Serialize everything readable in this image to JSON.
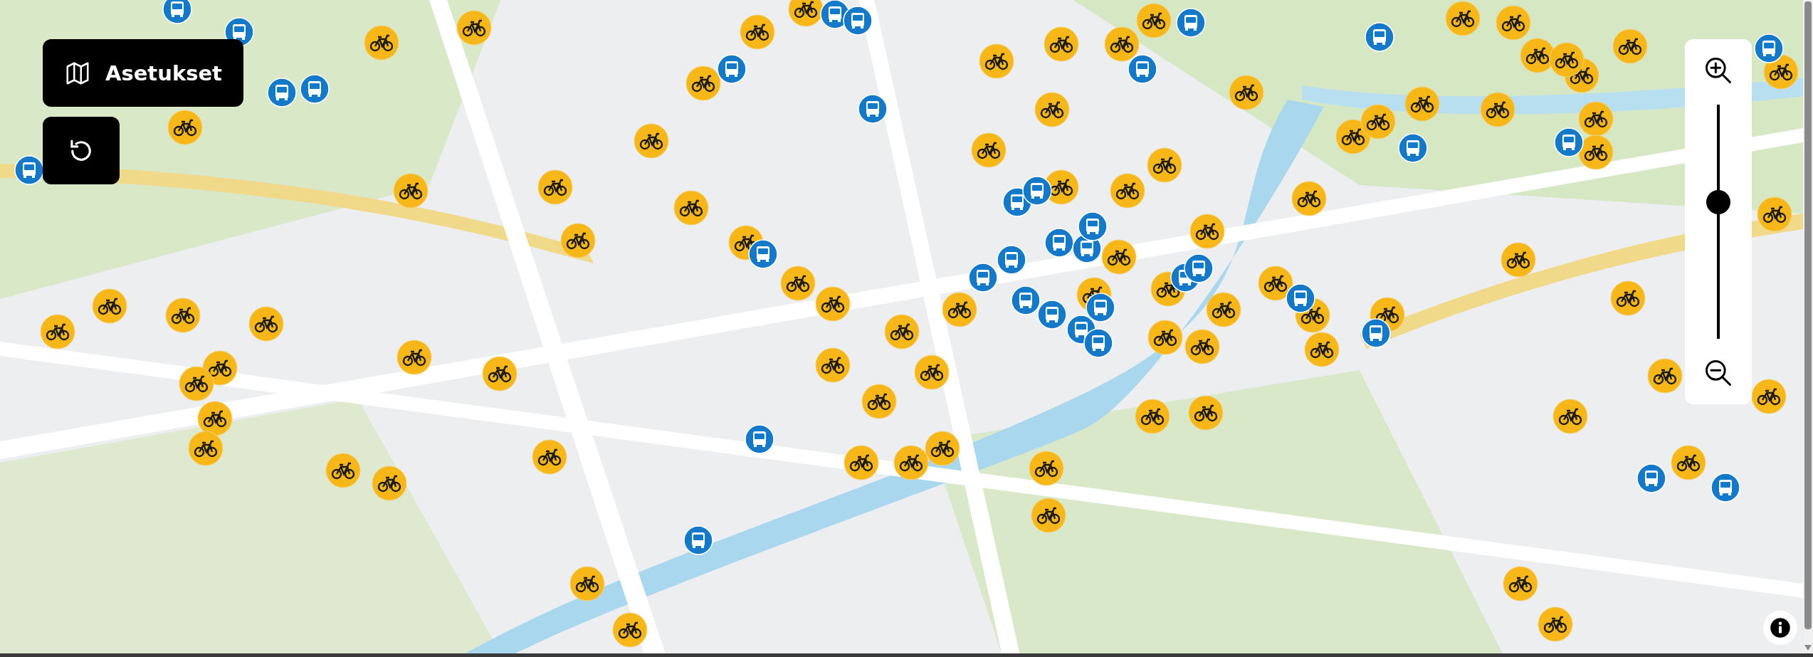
{
  "settings_button": {
    "label": "Asetukset"
  },
  "zoom_slider": {
    "level": 0.585
  }
}
